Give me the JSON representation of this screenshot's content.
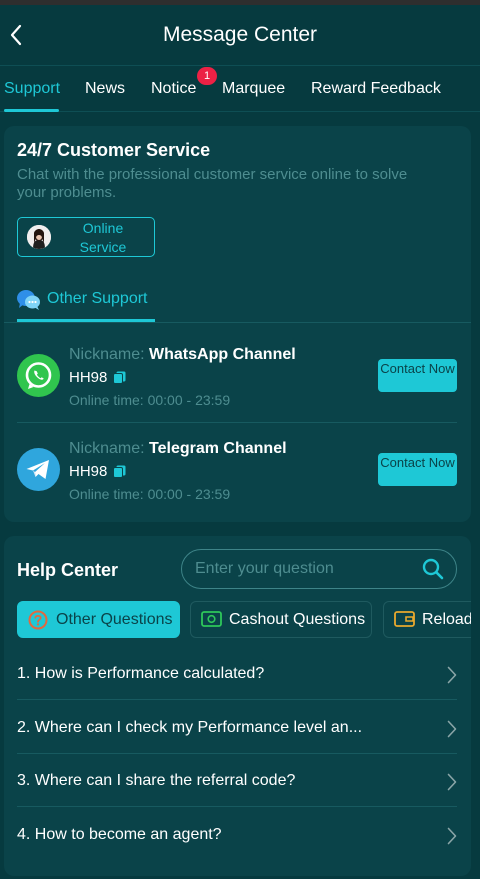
{
  "header": {
    "title": "Message Center"
  },
  "tabs": [
    {
      "label": "Support",
      "active": true
    },
    {
      "label": "News"
    },
    {
      "label": "Notice",
      "badge": "1"
    },
    {
      "label": "Marquee"
    },
    {
      "label": "Reward Feedback"
    }
  ],
  "support": {
    "title": "24/7 Customer Service",
    "description": "Chat with the professional customer service online to solve your problems.",
    "online_button": "Online Service",
    "other_support_label": "Other Support",
    "channels": [
      {
        "nickname_label": "Nickname:",
        "nickname": "WhatsApp Channel",
        "id": "HH98",
        "online_label": "Online time:",
        "online_time": "00:00 - 23:59",
        "button": "Contact Now",
        "icon": "whatsapp-icon"
      },
      {
        "nickname_label": "Nickname:",
        "nickname": "Telegram Channel",
        "id": "HH98",
        "online_label": "Online time:",
        "online_time": "00:00 - 23:59",
        "button": "Contact Now",
        "icon": "telegram-icon"
      }
    ]
  },
  "help": {
    "title": "Help Center",
    "search_placeholder": "Enter your question",
    "categories": [
      {
        "label": "Other Questions",
        "active": true
      },
      {
        "label": "Cashout Questions"
      },
      {
        "label": "Reload"
      }
    ],
    "questions": [
      "1. How is Performance calculated?",
      "2. Where can I check my Performance level an...",
      "3. Where can I share the referral code?",
      "4. How to become an agent?"
    ]
  },
  "colors": {
    "background": "#063a3f",
    "card": "#0a4349",
    "accent": "#1ec8d6",
    "badge": "#ec2145",
    "muted": "#4e8d90"
  }
}
